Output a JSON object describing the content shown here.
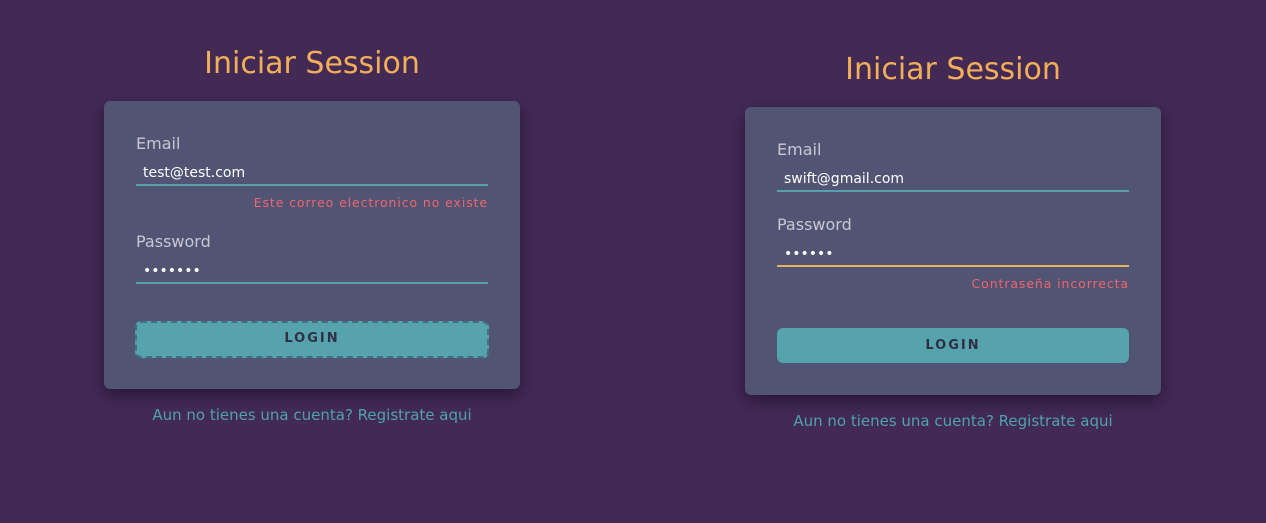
{
  "colors": {
    "background": "#422a55",
    "card": "#515473",
    "title": "#f2ae59",
    "accent": "#56a2ad",
    "error": "#f0646d",
    "warning_underline": "#e7b15c"
  },
  "left_form": {
    "title": "Iniciar Session",
    "email_label": "Email",
    "email_value": "test@test.com",
    "email_error": "Este correo electronico no existe",
    "password_label": "Password",
    "password_value": "•••••••",
    "login_label": "LOGIN",
    "register_text": "Aun no tienes una cuenta? Registrate aqui"
  },
  "right_form": {
    "title": "Iniciar Session",
    "email_label": "Email",
    "email_value": "swift@gmail.com",
    "password_label": "Password",
    "password_value": "••••••",
    "password_error": "Contraseña incorrecta",
    "login_label": "LOGIN",
    "register_text": "Aun no tienes una cuenta? Registrate aqui"
  }
}
